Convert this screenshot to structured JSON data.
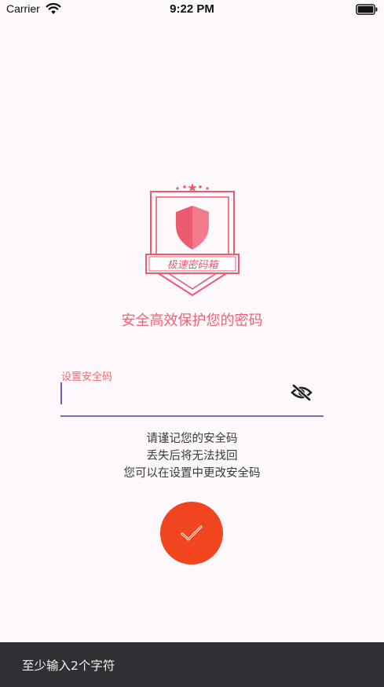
{
  "status_bar": {
    "carrier": "Carrier",
    "time": "9:22 PM"
  },
  "logo": {
    "name": "极速密码箱",
    "color": "#ec5a70"
  },
  "slogan": "安全高效保护您的密码",
  "form": {
    "field_label": "设置安全码",
    "value": ""
  },
  "hints": {
    "line1": "请谨记您的安全码",
    "line2": "丢失后将无法找回",
    "line3": "您可以在设置中更改安全码"
  },
  "snackbar": {
    "message": "至少输入2个字符"
  },
  "colors": {
    "accent": "#f0451e",
    "underline": "#7d6db8",
    "label": "#f06b6b",
    "slogan": "#ec6477",
    "snackbar_bg": "#2f3033"
  },
  "icons": {
    "wifi": "wifi-icon",
    "battery": "battery-icon",
    "shield": "shield-icon",
    "visibility": "eye-off-icon",
    "confirm": "check-icon"
  }
}
